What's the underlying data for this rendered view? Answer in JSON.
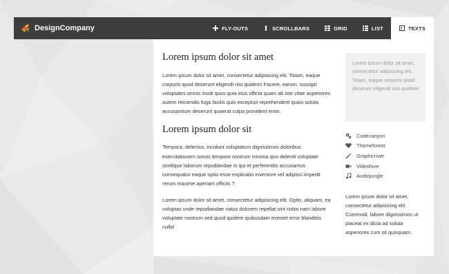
{
  "brand": {
    "name": "DesignCompany"
  },
  "nav": {
    "items": [
      {
        "label": "FLY-OUTS",
        "icon": "plus-icon"
      },
      {
        "label": "SCROLLBARS",
        "icon": "vertical-arrows-icon"
      },
      {
        "label": "GRID",
        "icon": "grid-icon"
      },
      {
        "label": "LIST",
        "icon": "list-icon"
      },
      {
        "label": "TEXTS",
        "icon": "text-box-icon",
        "active": true
      }
    ]
  },
  "main": {
    "heading1": "Lorem ipsum dolor sit amet",
    "paragraph1": "Lorem ipsum dolor sit amet, consectetur adipisicing elit. Totam, eaque corporis quod deserunt eligendi nisi quidem! Facere, earum, suscipit voluptates omnis modi quos quia eius officia quam ab iste vitae asperiores autem reiciendis fuga facilis quis excepturi reprehenderit quasi soluta accusantium deserunt quaerat culpa provident enim.",
    "heading2": "Lorem ipsum dolor sit",
    "paragraph2": "Tempora, delectus, incidunt voluptatum dignissimos doloribus exercitationem omnis tempore nostrum minima quo deleniti voluptate similique laborum repudiandae in qui et perferendis accusamus consequatur eaque optio esse explicabo inventore vel adipisci impedit rerum maxime aperiam officiis ?",
    "paragraph3": "Lorem ipsum dolor sit amet, consectetur adipisicing elit. Optio, aliquam, ea voluptas unde repudiandae natus dolorem repellat sint nobis nam labore voluptate nostrum sed quod quidem quibusdam eveniet error blanditiis nulla!"
  },
  "sidebar": {
    "quote": "Lorem ipsum dolor sit amet, consectetur adipisicing elit. Totam, eaque corporis quod deserunt eligendi nisi quidem!",
    "links": [
      {
        "label": "Codecanyon",
        "icon": "cogs-icon"
      },
      {
        "label": "Themeforest",
        "icon": "heart-icon"
      },
      {
        "label": "Graphicriver",
        "icon": "magic-wand-icon"
      },
      {
        "label": "Videohive",
        "icon": "video-camera-icon"
      },
      {
        "label": "Audiojungle",
        "icon": "music-note-icon"
      }
    ],
    "text": "Lorem ipsum dolor sit amet, consectetur adipisicing elit. Commodi, labore dignissimos ut placeat ex dicta ad soluta asperiores cum sit quisquam."
  },
  "colors": {
    "navbar": "#3d3d3d",
    "background": "#e9e9ea",
    "panel": "#ffffff",
    "quote_box": "#f0f0f0"
  }
}
